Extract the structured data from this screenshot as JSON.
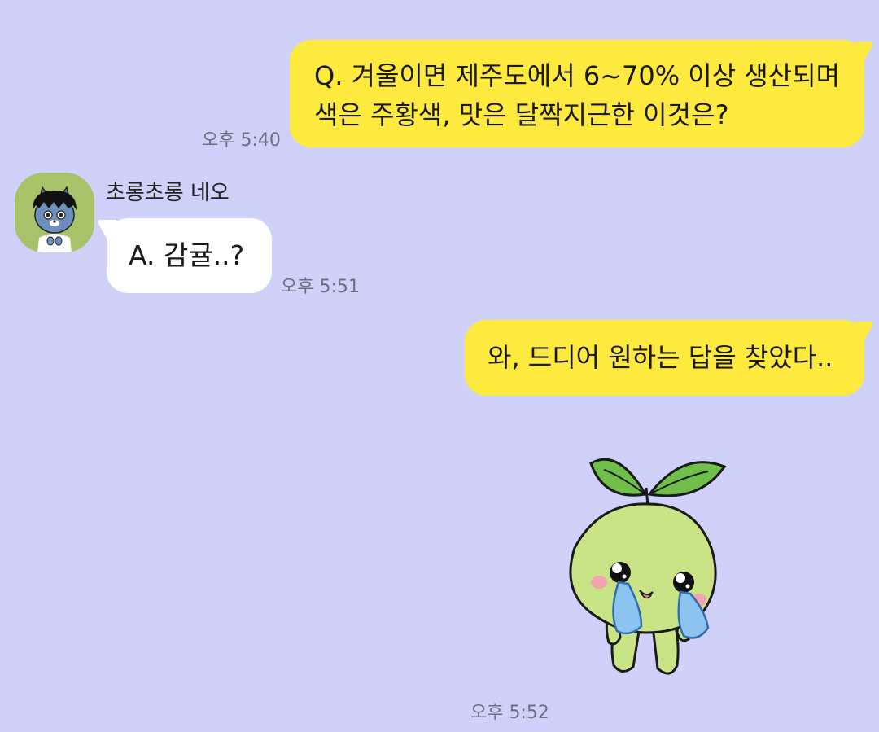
{
  "colors": {
    "background": "#cfd1f8",
    "my_bubble": "#fee93f",
    "their_bubble": "#ffffff",
    "timestamp": "#6d6e80"
  },
  "messages": [
    {
      "from": "me",
      "lines": [
        "Q. 겨울이면 제주도에서 6~70% 이상 생산되며",
        "색은 주황색, 맛은 달짝지근한 이것은?"
      ],
      "time": "오후 5:40"
    },
    {
      "from": "them",
      "sender_name": "초롱초롱 네오",
      "avatar_icon": "neo-character-avatar-icon",
      "lines": [
        "A. 감귤..?"
      ],
      "time": "오후 5:51"
    },
    {
      "from": "me",
      "lines": [
        "와, 드디어 원하는 답을 찾았다.."
      ],
      "time": ""
    },
    {
      "from": "me",
      "sticker_icon": "crying-sprout-sticker-icon",
      "time": "오후 5:52"
    }
  ]
}
